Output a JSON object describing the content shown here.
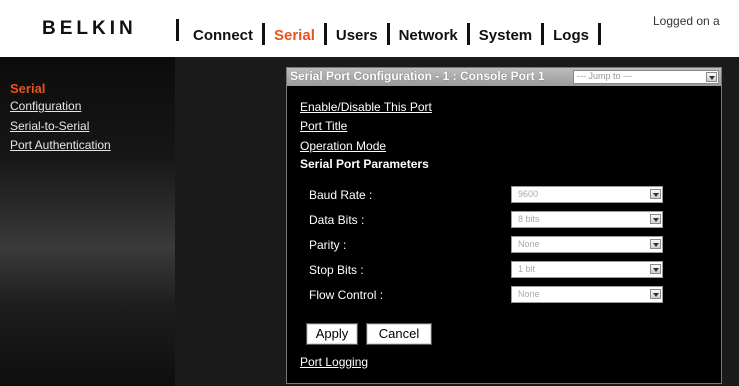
{
  "header": {
    "logo": "BELKIN",
    "nav": [
      {
        "label": "Connect",
        "active": false
      },
      {
        "label": "Serial",
        "active": true
      },
      {
        "label": "Users",
        "active": false
      },
      {
        "label": "Network",
        "active": false
      },
      {
        "label": "System",
        "active": false
      },
      {
        "label": "Logs",
        "active": false
      }
    ],
    "logged_on": "Logged on a"
  },
  "sidebar": {
    "title": "Serial",
    "links": [
      "Configuration",
      "Serial-to-Serial",
      "Port Authentication"
    ]
  },
  "panel": {
    "title": "Serial Port Configuration - 1 : Console Port 1",
    "jump_to": "--- Jump to ---",
    "links": {
      "enable_disable": "Enable/Disable This Port",
      "port_title": "Port Title",
      "operation_mode": "Operation Mode",
      "port_logging": "Port Logging"
    },
    "section_title": "Serial Port Parameters",
    "fields": [
      {
        "label": "Baud Rate :",
        "value": "9600"
      },
      {
        "label": "Data Bits :",
        "value": "8 bits"
      },
      {
        "label": "Parity :",
        "value": "None"
      },
      {
        "label": "Stop Bits :",
        "value": "1 bit"
      },
      {
        "label": "Flow Control :",
        "value": "None"
      }
    ],
    "buttons": {
      "apply": "Apply",
      "cancel": "Cancel"
    }
  },
  "colors": {
    "accent": "#e8531e",
    "background": "#1a1a1a",
    "header_bg": "#ffffff"
  }
}
